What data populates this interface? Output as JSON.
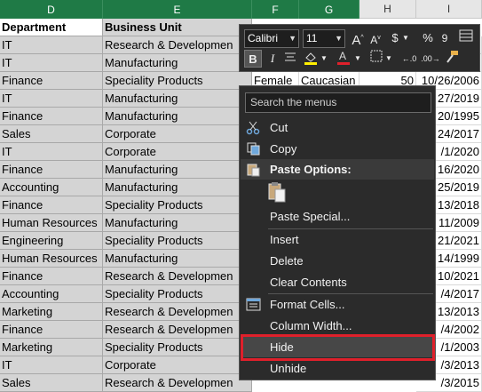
{
  "columns": [
    "D",
    "E",
    "F",
    "G",
    "H",
    "I"
  ],
  "header_row": {
    "department": "Department",
    "business_unit": "Business Unit"
  },
  "rows": [
    {
      "dept": "IT",
      "unit": "Research & Developmen",
      "date": ""
    },
    {
      "dept": "IT",
      "unit": "Manufacturing",
      "date": ""
    },
    {
      "dept": "Finance",
      "unit": "Speciality Products",
      "gender": "Female",
      "ethnicity": "Caucasian",
      "age": "50",
      "date": "10/26/2006"
    },
    {
      "dept": "IT",
      "unit": "Manufacturing",
      "date": "27/2019"
    },
    {
      "dept": "Finance",
      "unit": "Manufacturing",
      "date": "20/1995"
    },
    {
      "dept": "Sales",
      "unit": "Corporate",
      "date": "24/2017"
    },
    {
      "dept": "IT",
      "unit": "Corporate",
      "date": "/1/2020"
    },
    {
      "dept": "Finance",
      "unit": "Manufacturing",
      "date": "16/2020"
    },
    {
      "dept": "Accounting",
      "unit": "Manufacturing",
      "date": "25/2019"
    },
    {
      "dept": "Finance",
      "unit": "Speciality Products",
      "date": "13/2018"
    },
    {
      "dept": "Human Resources",
      "unit": "Manufacturing",
      "date": "11/2009"
    },
    {
      "dept": "Engineering",
      "unit": "Speciality Products",
      "date": "21/2021"
    },
    {
      "dept": "Human Resources",
      "unit": "Manufacturing",
      "date": "14/1999"
    },
    {
      "dept": "Finance",
      "unit": "Research & Developmen",
      "date": "10/2021"
    },
    {
      "dept": "Accounting",
      "unit": "Speciality Products",
      "date": "/4/2017"
    },
    {
      "dept": "Marketing",
      "unit": "Research & Developmen",
      "date": "13/2013"
    },
    {
      "dept": "Finance",
      "unit": "Research & Developmen",
      "date": "/4/2002"
    },
    {
      "dept": "Marketing",
      "unit": "Speciality Products",
      "date": "/1/2003"
    },
    {
      "dept": "IT",
      "unit": "Corporate",
      "date": "/3/2013"
    },
    {
      "dept": "Sales",
      "unit": "Research & Developmen",
      "date": "/3/2015"
    }
  ],
  "mini_toolbar": {
    "font_name": "Calibri",
    "font_size": "11",
    "grow_font": "A",
    "shrink_font": "A",
    "currency": "$",
    "percent": "%",
    "comma": "9",
    "bold": "B",
    "italic": "I"
  },
  "context_menu": {
    "search_placeholder": "Search the menus",
    "cut": "Cut",
    "copy": "Copy",
    "paste_options": "Paste Options:",
    "paste_special": "Paste Special...",
    "insert": "Insert",
    "delete": "Delete",
    "clear_contents": "Clear Contents",
    "format_cells": "Format Cells...",
    "column_width": "Column Width...",
    "hide": "Hide",
    "unhide": "Unhide"
  },
  "colors": {
    "selected_header": "#1f7a46",
    "menu_bg": "#2b2b2b",
    "highlight_box": "#e0202b",
    "selection_fill": "#d4d4d4"
  }
}
